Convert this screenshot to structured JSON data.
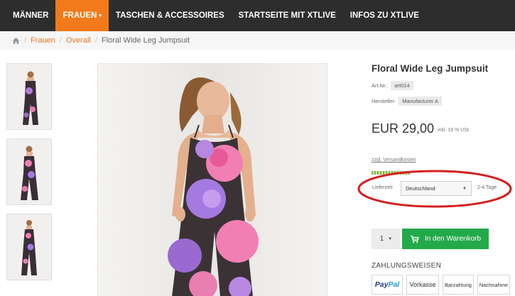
{
  "nav": {
    "items": [
      {
        "label": "MÄNNER",
        "active": false
      },
      {
        "label": "FRAUEN",
        "active": true
      },
      {
        "label": "TASCHEN & ACCESSOIRES",
        "active": false
      },
      {
        "label": "STARTSEITE MIT XTLIVE",
        "active": false
      },
      {
        "label": "INFOS ZU XTLIVE",
        "active": false
      }
    ],
    "dropdown_caret": "▾"
  },
  "breadcrumb": {
    "sep": "/",
    "items": [
      "Frauen",
      "Overall"
    ],
    "current": "Floral Wide Leg Jumpsuit"
  },
  "product": {
    "title": "Floral Wide Leg Jumpsuit",
    "art_label": "Art.Nr.:",
    "art_value": "art014",
    "manufacturer_label": "Hersteller:",
    "manufacturer_value": "Manufacturer A",
    "price": "EUR 29,00",
    "tax": "inkl. 19 % USt",
    "shipping": "zzgl. Versandkosten",
    "delivery_label": "Lieferzeit",
    "country": "Deutschland",
    "delivery_time": "2-4 Tage",
    "select_caret": "▼"
  },
  "cart": {
    "qty": "1",
    "qty_caret": "▼",
    "button": "In den Warenkorb"
  },
  "payment": {
    "heading": "ZAHLUNGSWEISEN",
    "paypal_a": "Pay",
    "paypal_b": "Pal",
    "methods": [
      "Vorkasse",
      "Barzahlung",
      "Nachnahme"
    ]
  },
  "colors": {
    "nav_bg": "#2d2d2d",
    "accent": "#f27a1a",
    "cart_green": "#22a94a",
    "annotation_red": "#d42020"
  },
  "icons": [
    "home-icon",
    "cart-icon",
    "chevron-down-icon"
  ]
}
